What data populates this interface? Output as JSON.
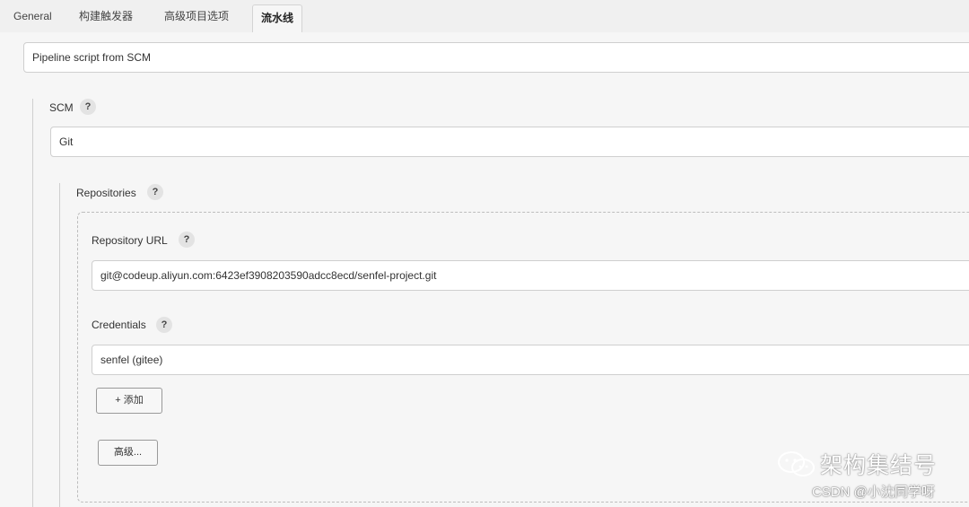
{
  "tabs": [
    {
      "label": "General"
    },
    {
      "label": "构建触发器"
    },
    {
      "label": "高级项目选项"
    },
    {
      "label": "流水线"
    }
  ],
  "definition": {
    "value": "Pipeline script from SCM"
  },
  "scm": {
    "label": "SCM",
    "help": "?",
    "value": "Git"
  },
  "repositories": {
    "label": "Repositories",
    "help": "?"
  },
  "repository_url": {
    "label": "Repository URL",
    "help": "?",
    "value": "git@codeup.aliyun.com:6423ef3908203590adcc8ecd/senfel-project.git"
  },
  "credentials": {
    "label": "Credentials",
    "help": "?",
    "value": "senfel (gitee)"
  },
  "buttons": {
    "add": "+ 添加",
    "advanced": "高级..."
  },
  "watermark": {
    "main": "架构集结号",
    "sub": "CSDN @小沈同学呀"
  }
}
